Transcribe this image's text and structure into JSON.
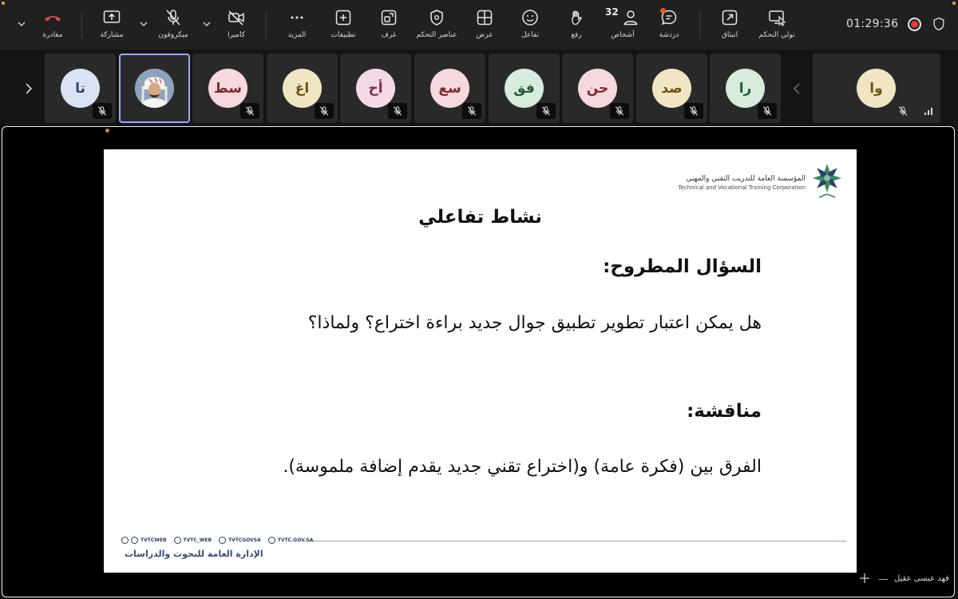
{
  "toolbar": {
    "leave_label": "مغادرة",
    "share_label": "مشاركة",
    "mic_label": "ميكروفون",
    "camera_label": "كاميرا",
    "more_label": "المزيد",
    "apps_label": "تطبيقات",
    "rooms_label": "غرف",
    "host_controls_label": "عناصر التحكم",
    "view_label": "عرض",
    "react_label": "تفاعل",
    "raise_label": "رفع",
    "people_label": "أشخاص",
    "people_count": "32",
    "chat_label": "دردشة",
    "popout_label": "انبثاق",
    "take_control_label": "تولي التحكم",
    "timer": "01:29:36"
  },
  "participants": [
    {
      "initials": "تا",
      "bg": "#d9e3f4",
      "fg": "#33486e"
    },
    {
      "initials": "",
      "photo": true
    },
    {
      "initials": "سط",
      "bg": "#f5d9dc",
      "fg": "#7b2a33"
    },
    {
      "initials": "اغ",
      "bg": "#f1e6c3",
      "fg": "#6b5514"
    },
    {
      "initials": "أح",
      "bg": "#f4d9e6",
      "fg": "#7a2e55"
    },
    {
      "initials": "سع",
      "bg": "#f5d9dc",
      "fg": "#7b2a33"
    },
    {
      "initials": "فق",
      "bg": "#d6ecdc",
      "fg": "#255a35"
    },
    {
      "initials": "حن",
      "bg": "#f5d9dc",
      "fg": "#7b2a33"
    },
    {
      "initials": "صد",
      "bg": "#f1e6c3",
      "fg": "#6b5514"
    },
    {
      "initials": "را",
      "bg": "#d6ecdc",
      "fg": "#255a35"
    },
    {
      "initials": "وا",
      "bg": "#f1e6c3",
      "fg": "#6b5514"
    }
  ],
  "slide": {
    "org_ar": "المؤسسة العامة للتدريب التقني والمهني",
    "org_en": "Technical and Vocational Training Corporation",
    "title": "نشاط تفاعلي",
    "question_heading": "السؤال المطروح:",
    "question_text": "هل يمكن اعتبار تطوير تطبيق جوال جديد براءة اختراع؟ ولماذا؟",
    "discussion_heading": "مناقشة:",
    "discussion_text": "الفرق بين (فكرة عامة) و(اختراع تقني جديد يقدم إضافة ملموسة).",
    "handles": [
      "TVTCWEB",
      "TVTC_WEB",
      "TVTCGOVSA",
      "TVTC.GOV.SA"
    ],
    "department": "الإدارة العامة للبحوث والدراسات"
  },
  "presenter_name": "فهد عيسى عقيل",
  "colors": {
    "leave": "#e5484d",
    "accent": "#9aa6ff",
    "record": "#e23a3a",
    "notification": "#e8532e"
  }
}
